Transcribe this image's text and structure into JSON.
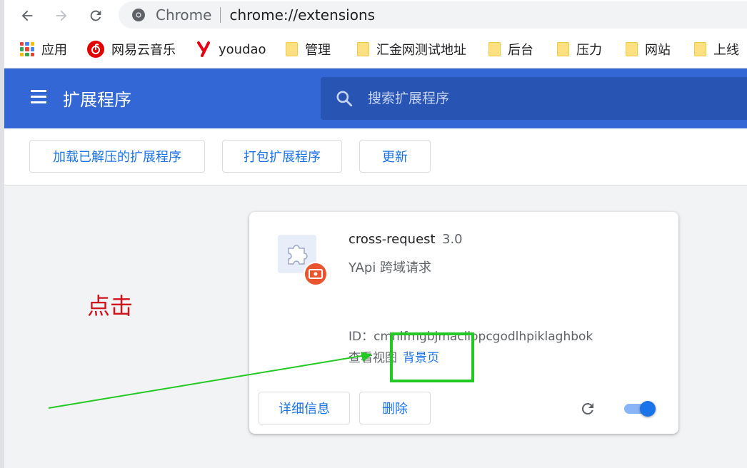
{
  "browser": {
    "omnibox": {
      "site": "Chrome",
      "url": "chrome://extensions"
    }
  },
  "bookmarks": [
    {
      "label": "应用",
      "icon": "apps-grid-icon"
    },
    {
      "label": "网易云音乐",
      "icon": "netease-music-icon"
    },
    {
      "label": "youdao",
      "icon": "youdao-icon"
    },
    {
      "label": "管理",
      "icon": "folder-icon"
    },
    {
      "label": "汇金网测试地址",
      "icon": "folder-icon"
    },
    {
      "label": "后台",
      "icon": "folder-icon"
    },
    {
      "label": "压力",
      "icon": "folder-icon"
    },
    {
      "label": "网站",
      "icon": "folder-icon"
    },
    {
      "label": "上线",
      "icon": "folder-icon"
    }
  ],
  "header": {
    "title": "扩展程序",
    "search_placeholder": "搜索扩展程序"
  },
  "devbar": {
    "load_unpacked": "加载已解压的扩展程序",
    "pack": "打包扩展程序",
    "update": "更新"
  },
  "extension": {
    "name": "cross-request",
    "version": "3.0",
    "description": "YApi 跨域请求",
    "id_label": "ID：",
    "id": "cmnlfmgbjmaciiopcgodlhpiklaghbok",
    "views_label": "查看视图",
    "background_link": "背景页",
    "details_button": "详细信息",
    "remove_button": "删除",
    "enabled": true
  },
  "annotation": {
    "text": "点击",
    "text_color": "#d0121b",
    "highlight_color": "#22c922"
  },
  "colors": {
    "header_bg": "#3367d6",
    "link": "#1a73e8"
  }
}
